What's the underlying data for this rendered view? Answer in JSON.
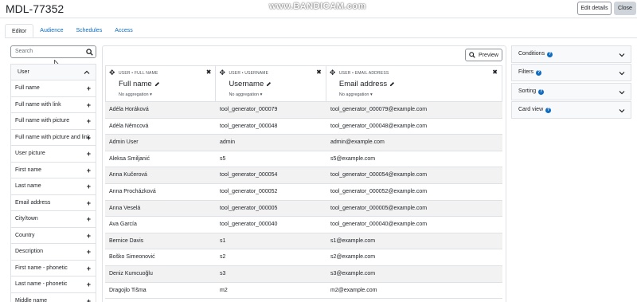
{
  "header": {
    "title": "MDL-77352",
    "watermark": "www.BANDICAM.com",
    "edit_details": "Edit details",
    "close": "Close"
  },
  "tabs": [
    "Editor",
    "Audience",
    "Schedules",
    "Access"
  ],
  "sidebar": {
    "search_placeholder": "Search",
    "section": "User",
    "items": [
      "Full name",
      "Full name with link",
      "Full name with picture",
      "Full name with picture and link",
      "User picture",
      "First name",
      "Last name",
      "Email address",
      "City/town",
      "Country",
      "Description",
      "First name - phonetic",
      "Last name - phonetic",
      "Middle name"
    ]
  },
  "preview_label": "Preview",
  "columns": [
    {
      "meta": "USER • FULL NAME",
      "name": "Full name",
      "aggregation": "No aggregation"
    },
    {
      "meta": "USER • USERNAME",
      "name": "Username",
      "aggregation": "No aggregation"
    },
    {
      "meta": "USER • EMAIL ADDRESS",
      "name": "Email address",
      "aggregation": "No aggregation"
    }
  ],
  "rows": [
    [
      "Adéla Horáková",
      "tool_generator_000079",
      "tool_generator_000079@example.com"
    ],
    [
      "Adéla Němcová",
      "tool_generator_000048",
      "tool_generator_000048@example.com"
    ],
    [
      "Admin User",
      "admin",
      "admin@example.com"
    ],
    [
      "Aleksa Smiljanić",
      "s5",
      "s5@example.com"
    ],
    [
      "Anna Kučerová",
      "tool_generator_000054",
      "tool_generator_000054@example.com"
    ],
    [
      "Anna Procházková",
      "tool_generator_000052",
      "tool_generator_000052@example.com"
    ],
    [
      "Anna Veselá",
      "tool_generator_000005",
      "tool_generator_000005@example.com"
    ],
    [
      "Ava García",
      "tool_generator_000040",
      "tool_generator_000040@example.com"
    ],
    [
      "Bernice Davis",
      "s1",
      "s1@example.com"
    ],
    [
      "Boško Simeonović",
      "s2",
      "s2@example.com"
    ],
    [
      "Deniz Kumcuoğlu",
      "s3",
      "s3@example.com"
    ],
    [
      "Dragojlo Tišma",
      "m2",
      "m2@example.com"
    ]
  ],
  "settings": [
    "Conditions",
    "Filters",
    "Sorting",
    "Card view"
  ],
  "colors": {
    "accent": "#0f6cbf",
    "border": "#dee2e6",
    "stripe": "#f2f2f2"
  }
}
